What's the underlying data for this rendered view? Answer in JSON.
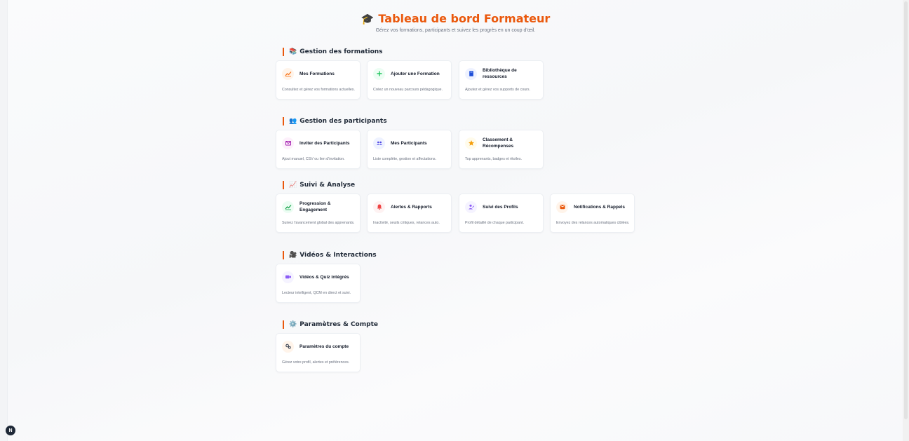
{
  "header": {
    "emoji": "🎓",
    "title": "Tableau de bord Formateur",
    "subtitle": "Gérez vos formations, participants et suivez les progrès en un coup d'œil."
  },
  "sections": [
    {
      "emoji": "📚",
      "title": "Gestion des formations",
      "cards": [
        {
          "title": "Mes Formations",
          "desc": "Consultez et gérez vos formations actuelles.",
          "icon": "chart-icon"
        },
        {
          "title": "Ajouter une Formation",
          "desc": "Créez un nouveau parcours pédagogique.",
          "icon": "plus-icon"
        },
        {
          "title": "Bibliothèque de ressources",
          "desc": "Ajoutez et gérez vos supports de cours.",
          "icon": "book-icon"
        }
      ]
    },
    {
      "emoji": "👥",
      "title": "Gestion des participants",
      "cards": [
        {
          "title": "Inviter des Participants",
          "desc": "Ajout manuel, CSV ou lien d'invitation.",
          "icon": "envelope-icon"
        },
        {
          "title": "Mes Participants",
          "desc": "Liste complète, gestion et affectations.",
          "icon": "users-icon"
        },
        {
          "title": "Classement & Récompenses",
          "desc": "Top apprenants, badges et étoiles.",
          "icon": "star-icon"
        }
      ]
    },
    {
      "emoji": "📈",
      "title": "Suivi & Analyse",
      "cards": [
        {
          "title": "Progression & Engagement",
          "desc": "Suivez l'avancement global des apprenants.",
          "icon": "trend-icon"
        },
        {
          "title": "Alertes & Rapports",
          "desc": "Inactivité, seuils critiques, relances auto.",
          "icon": "bell-icon"
        },
        {
          "title": "Suivi des Profils",
          "desc": "Profil détaillé de chaque participant.",
          "icon": "user-edit-icon"
        },
        {
          "title": "Notifications & Rappels",
          "desc": "Envoyez des relances automatiques ciblées.",
          "icon": "notification-icon"
        }
      ]
    },
    {
      "emoji": "🎥",
      "title": "Vidéos & Interactions",
      "cards": [
        {
          "title": "Vidéos & Quiz intégrés",
          "desc": "Lecteur intelligent, QCM en direct et suivi.",
          "icon": "video-icon"
        }
      ]
    },
    {
      "emoji": "⚙️",
      "title": "Paramètres & Compte",
      "cards": [
        {
          "title": "Paramètres du compte",
          "desc": "Gérez votre profil, alertes et préférences.",
          "icon": "gears-icon"
        }
      ]
    }
  ],
  "dev_badge": "N",
  "colors": {
    "accent": "#ea580c",
    "orange": "#f97316",
    "green": "#22c55e",
    "blue": "#1d4ed8",
    "purple": "#a21caf",
    "indigo": "#4f46e5",
    "amber": "#f59e0b",
    "red": "#ef4444",
    "violet": "#8b5cf6"
  }
}
